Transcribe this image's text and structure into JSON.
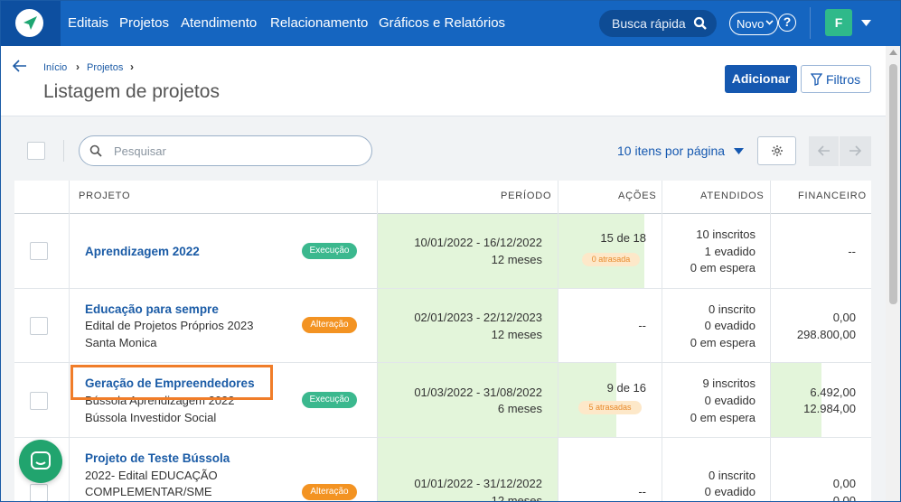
{
  "nav": {
    "items": [
      "Editais",
      "Projetos",
      "Atendimento",
      "Relacionamento",
      "Gráficos e Relatórios"
    ],
    "search_label": "Busca rápida",
    "new_label": "Novo",
    "help_label": "?",
    "avatar_initial": "F"
  },
  "breadcrumb": {
    "home": "Início",
    "projects": "Projetos",
    "sep": "›"
  },
  "page": {
    "title": "Listagem de projetos",
    "add_label": "Adicionar",
    "filter_label": "Filtros"
  },
  "toolbar": {
    "search_placeholder": "Pesquisar",
    "per_page": "10 itens por página"
  },
  "table": {
    "headers": {
      "project": "PROJETO",
      "period": "PERÍODO",
      "actions": "AÇÕES",
      "attended": "ATENDIDOS",
      "financial": "FINANCEIRO"
    },
    "rows": [
      {
        "title": "Aprendizagem 2022",
        "sub1": "",
        "sub2": "",
        "status": "Execução",
        "period": "10/01/2022 - 16/12/2022",
        "duration": "12 meses",
        "actions": "15 de 18",
        "late": "0 atrasada",
        "att1": "10 inscritos",
        "att2": "1 evadido",
        "att3": "0 em espera",
        "fin1": "--",
        "fin2": "",
        "actions_progress": 0.83,
        "financial_progress": 0
      },
      {
        "title": "Educação para sempre",
        "sub1": "Edital de Projetos Próprios 2023",
        "sub2": "Santa Monica",
        "status": "Alteração",
        "period": "02/01/2023 - 22/12/2023",
        "duration": "12 meses",
        "actions": "--",
        "late": "",
        "att1": "0 inscrito",
        "att2": "0 evadido",
        "att3": "0 em espera",
        "fin1": "0,00",
        "fin2": "298.800,00",
        "actions_progress": 0,
        "financial_progress": 0
      },
      {
        "title": "Geração de Empreendedores",
        "sub1": "Bússola Aprendizagem 2022",
        "sub2": "Bússola Investidor Social",
        "status": "Execução",
        "period": "01/03/2022 - 31/08/2022",
        "duration": "6 meses",
        "actions": "9 de 16",
        "late": "5 atrasadas",
        "att1": "9 inscritos",
        "att2": "0 evadido",
        "att3": "0 em espera",
        "fin1": "6.492,00",
        "fin2": "12.984,00",
        "actions_progress": 0.56,
        "financial_progress": 0.5
      },
      {
        "title": "Projeto de Teste Bússola",
        "sub1": "2022- Edital EDUCAÇÃO",
        "sub2": "COMPLEMENTAR/SME",
        "status": "Alteração",
        "period": "01/01/2022 - 31/12/2022",
        "duration": "12 meses",
        "actions": "--",
        "late": "",
        "att1": "0 inscrito",
        "att2": "0 evadido",
        "att3": "",
        "fin1": "0,00",
        "fin2": "0,00",
        "actions_progress": 0,
        "financial_progress": 0
      }
    ]
  },
  "colors": {
    "brand": "#1565c0",
    "execution": "#3bb88e",
    "alteration": "#f39322",
    "progress": "#e3f5da",
    "highlight": "#f07d29"
  }
}
